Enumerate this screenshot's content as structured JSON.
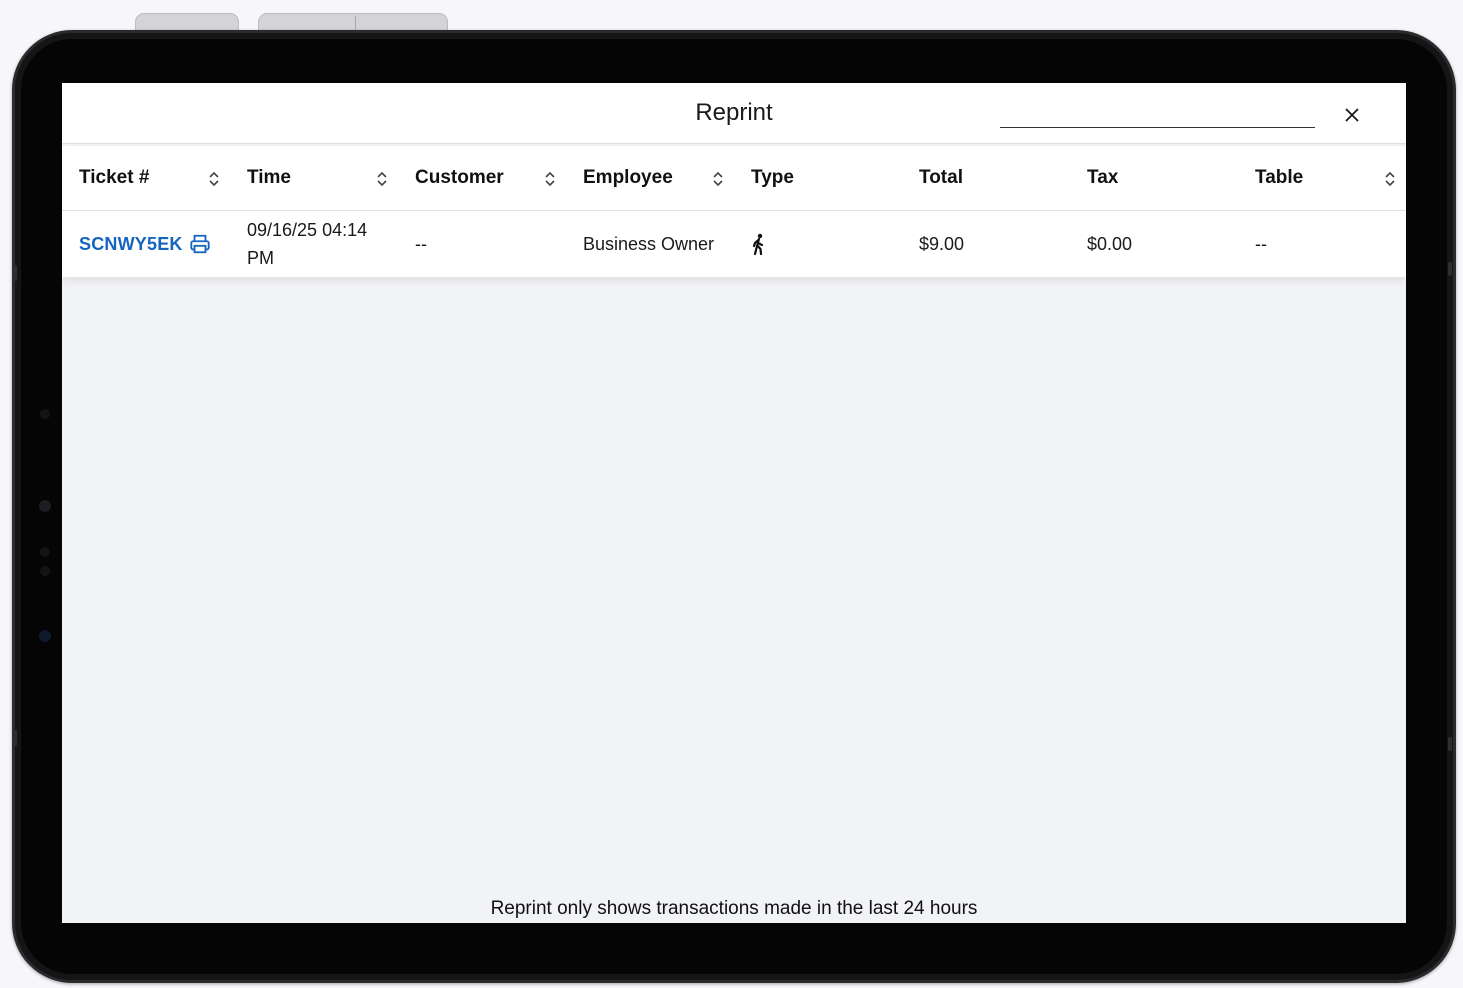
{
  "dialog": {
    "title": "Reprint",
    "search_value": "",
    "close_icon": "close-icon"
  },
  "table": {
    "columns": [
      {
        "label": "Ticket #",
        "sortable": true
      },
      {
        "label": "Time",
        "sortable": true
      },
      {
        "label": "Customer",
        "sortable": true
      },
      {
        "label": "Employee",
        "sortable": true
      },
      {
        "label": "Type",
        "sortable": false
      },
      {
        "label": "Total",
        "sortable": false
      },
      {
        "label": "Tax",
        "sortable": false
      },
      {
        "label": "Table",
        "sortable": true
      }
    ],
    "rows": [
      {
        "ticket": "SCNWY5EK",
        "time": "09/16/25 04:14 PM",
        "customer": "--",
        "employee": "Business Owner",
        "type_icon": "walk-in-icon",
        "total": "$9.00",
        "tax": "$0.00",
        "table": "--"
      }
    ]
  },
  "footer_note": "Reprint only shows transactions made in the last 24 hours",
  "colors": {
    "link": "#1565c0",
    "screen_bg": "#f2f3f7",
    "bezel": "#050505"
  }
}
